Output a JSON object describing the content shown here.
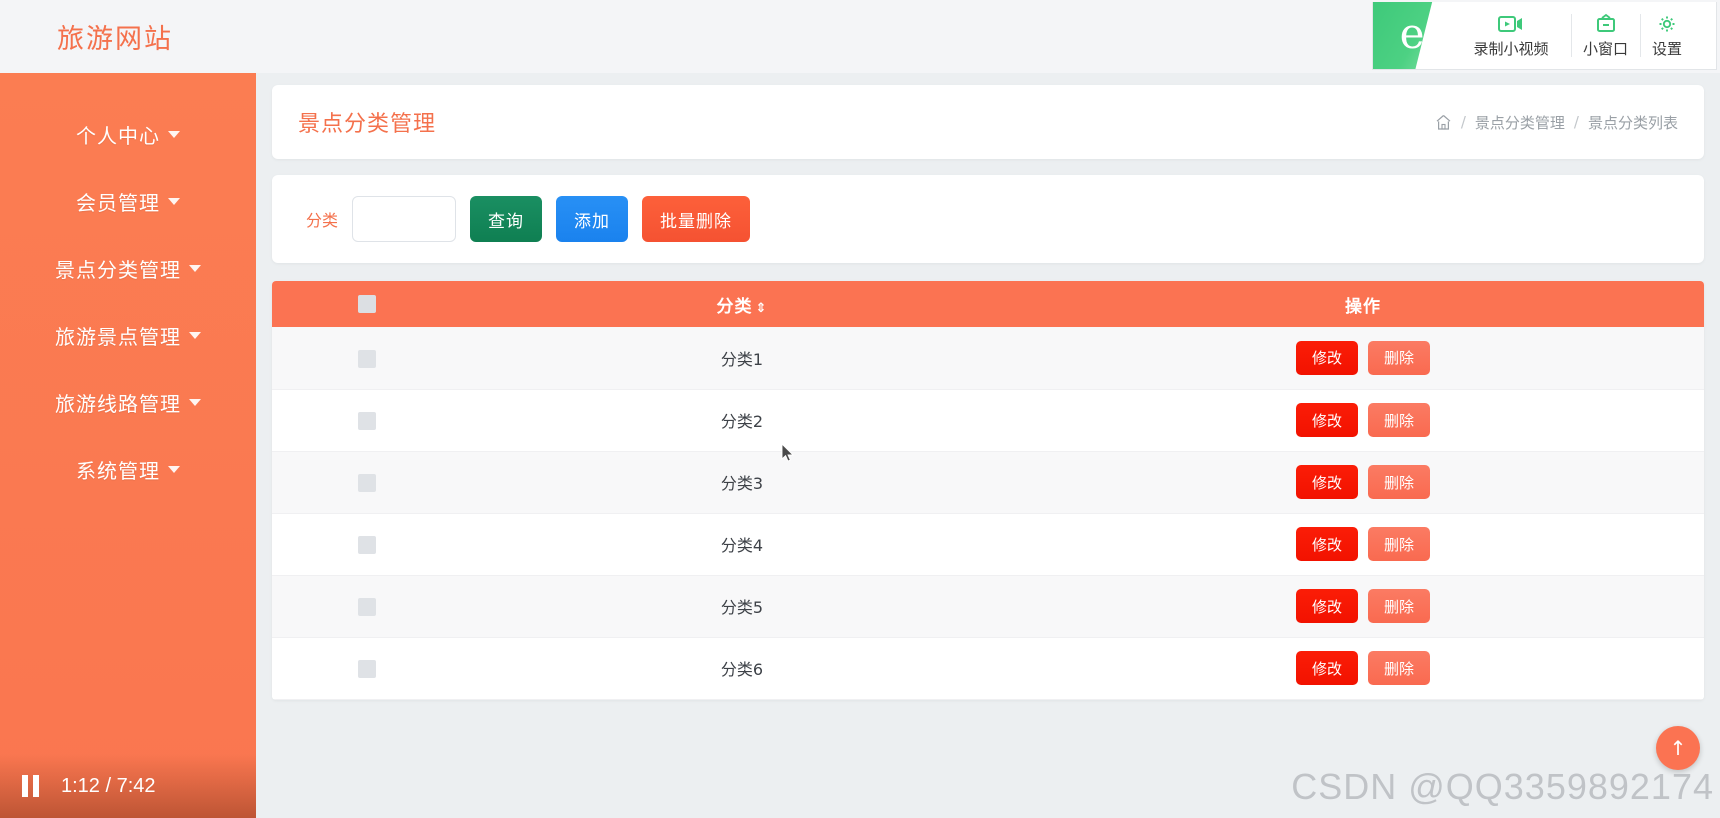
{
  "app": {
    "logo": "旅游网站"
  },
  "recorder": {
    "brand_glyph": "e",
    "items": [
      {
        "label": "录制小视频",
        "icon": "video-camera-icon"
      },
      {
        "label": "小窗口",
        "icon": "mini-window-icon"
      },
      {
        "label": "设置",
        "icon": "gear-icon"
      }
    ]
  },
  "sidebar": {
    "items": [
      {
        "label": "个人中心"
      },
      {
        "label": "会员管理"
      },
      {
        "label": "景点分类管理"
      },
      {
        "label": "旅游景点管理"
      },
      {
        "label": "旅游线路管理"
      },
      {
        "label": "系统管理"
      }
    ]
  },
  "page": {
    "title": "景点分类管理",
    "breadcrumb": {
      "home_icon": "home-icon",
      "items": [
        "景点分类管理",
        "景点分类列表"
      ],
      "separator": "/"
    }
  },
  "filter": {
    "label": "分类",
    "input_value": "",
    "input_placeholder": "",
    "buttons": {
      "query": "查询",
      "add": "添加",
      "batch_delete": "批量删除"
    }
  },
  "table": {
    "headers": {
      "select_all": "",
      "name": "分类",
      "sort_glyph": "⇕",
      "action": "操作"
    },
    "row_buttons": {
      "edit": "修改",
      "delete": "删除"
    },
    "rows": [
      {
        "name": "分类1"
      },
      {
        "name": "分类2"
      },
      {
        "name": "分类3"
      },
      {
        "name": "分类4"
      },
      {
        "name": "分类5"
      },
      {
        "name": "分类6"
      }
    ]
  },
  "fab": {
    "label": "↑"
  },
  "player": {
    "state": "playing",
    "time_display": "1:12 / 7:42"
  },
  "watermark": "CSDN @QQ3359892174",
  "colors": {
    "brand_orange": "#fb7352",
    "title_orange": "#f4714c",
    "query_green": "#0f7f52",
    "add_blue": "#2890f5",
    "batch_orange": "#f55232",
    "edit_red": "#f21200",
    "delete_salmon": "#f96a50",
    "recorder_green": "#4dd183"
  }
}
